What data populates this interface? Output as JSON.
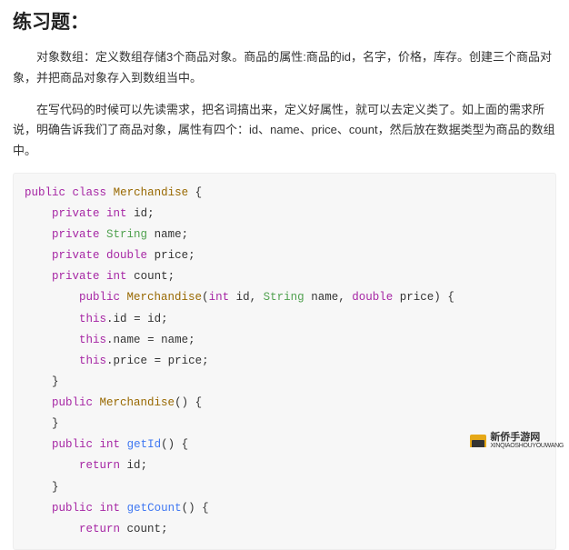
{
  "title": "练习题：",
  "para1": "对象数组：定义数组存储3个商品对象。商品的属性:商品的id，名字，价格，库存。创建三个商品对象，并把商品对象存入到数组当中。",
  "para2": "在写代码的时候可以先读需求，把名词搞出来，定义好属性，就可以去定义类了。如上面的需求所说，明确告诉我们了商品对象，属性有四个：id、name、price、count，然后放在数据类型为商品的数组中。",
  "code": {
    "kw_public": "public",
    "kw_class": "class",
    "kw_private": "private",
    "kw_return": "return",
    "type_int": "int",
    "type_String": "String",
    "type_double": "double",
    "cls_Merchandise": "Merchandise",
    "field_id": "id",
    "field_name": "name",
    "field_price": "price",
    "field_count": "count",
    "kw_this": "this",
    "fn_getId": "getId",
    "fn_getCount": "getCount",
    "brace_open": "{",
    "brace_close": "}",
    "paren_open": "(",
    "paren_close": ")",
    "semi": ";",
    "comma": ",",
    "eq": "=",
    "sp": " ",
    "dot": "."
  },
  "watermark": {
    "name": "新侨手游网",
    "url": "XINQIAOSHOUYOUWANG"
  }
}
